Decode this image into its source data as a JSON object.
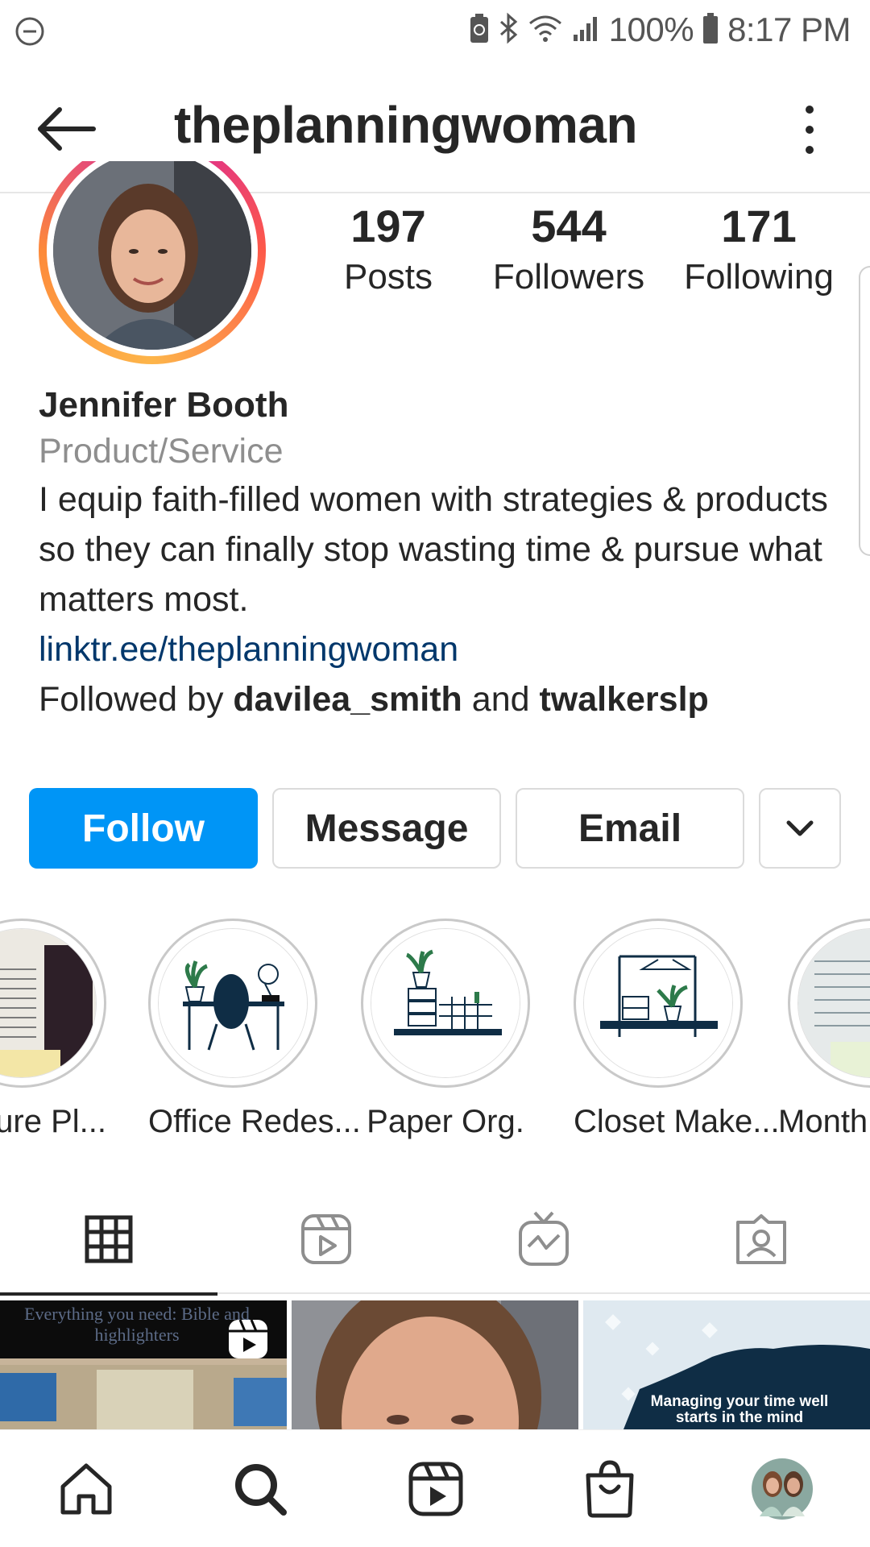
{
  "status_bar": {
    "battery": "100%",
    "time": "8:17 PM"
  },
  "header": {
    "username": "theplanningwoman"
  },
  "profile": {
    "stats": [
      {
        "value": "197",
        "label": "Posts"
      },
      {
        "value": "544",
        "label": "Followers"
      },
      {
        "value": "171",
        "label": "Following"
      }
    ],
    "name": "Jennifer Booth",
    "category": "Product/Service",
    "bio": "I equip faith-filled women with strategies & products so they can finally stop wasting time & pursue what matters most.",
    "link": "linktr.ee/theplanningwoman",
    "followed_by": {
      "prefix": "Followed by ",
      "user1": "davilea_smith",
      "joiner": " and ",
      "user2": "twalkerslp"
    }
  },
  "actions": {
    "follow": "Follow",
    "message": "Message",
    "email": "Email"
  },
  "highlights": [
    {
      "label": "ture Pl...",
      "icon": "scripture-plan-photo"
    },
    {
      "label": "Office Redes...",
      "icon": "office-desk-icon"
    },
    {
      "label": "Paper Org.",
      "icon": "shelf-plant-icon"
    },
    {
      "label": "Closet Make...",
      "icon": "closet-icon"
    },
    {
      "label": "Month",
      "icon": "monthly-plan-photo"
    }
  ],
  "tabs": [
    {
      "name": "grid-icon",
      "active": true
    },
    {
      "name": "reels-icon",
      "active": false
    },
    {
      "name": "igtv-icon",
      "active": false
    },
    {
      "name": "tagged-icon",
      "active": false
    }
  ],
  "posts": [
    {
      "caption": "Everything you need: Bible and highlighters"
    },
    {
      "caption": ""
    },
    {
      "caption": "Managing your time well starts in the mind"
    }
  ],
  "bottom_nav": [
    "home-icon",
    "search-icon",
    "reels-icon",
    "shop-icon",
    "profile-avatar"
  ],
  "colors": {
    "follow_button": "#0095f6",
    "link": "#00376b",
    "secondary_text": "#8e8e8e"
  }
}
